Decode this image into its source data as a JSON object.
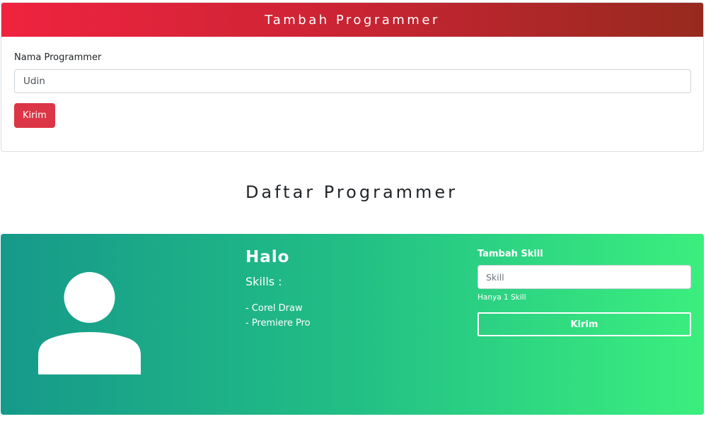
{
  "form_card": {
    "title": "Tambah Programmer",
    "name_label": "Nama Programmer",
    "name_value": "Udin",
    "submit_label": "Kirim"
  },
  "list_section": {
    "heading": "Daftar Programmer"
  },
  "programmer_card": {
    "name": "Halo",
    "skills_title": "Skills :",
    "skills": [
      "- Corel Draw",
      "- Premiere Pro"
    ],
    "avatar_icon": "user-silhouette-icon",
    "skill_form": {
      "label": "Tambah Skill",
      "placeholder": "Skill",
      "help_text": "Hanya 1 Skill",
      "submit_label": "Kirim"
    }
  },
  "colors": {
    "header_gradient": [
      "#f0233f",
      "#962a1f"
    ],
    "card_gradient": [
      "#16998a",
      "#3bef7e"
    ],
    "danger_button": "#dc3545"
  }
}
